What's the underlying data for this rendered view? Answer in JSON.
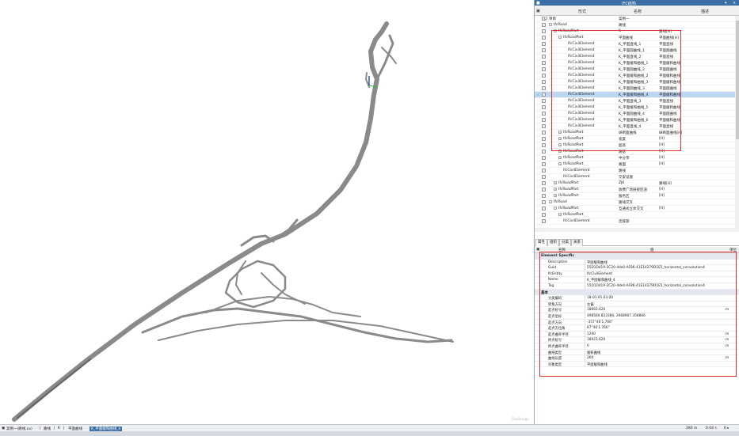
{
  "panel": {
    "title": "IFC结构",
    "columns": {
      "form": "形式",
      "name": "名称",
      "desc": "描述"
    },
    "tree_rows": [
      {
        "indent": 0,
        "form": "项目",
        "name": "案例一",
        "desc": "",
        "toggle": "−"
      },
      {
        "indent": 1,
        "form": "IfcRoad",
        "name": "路线",
        "desc": "",
        "toggle": "−"
      },
      {
        "indent": 2,
        "form": "IfcRoadPart",
        "name": "K",
        "desc": "路线[H]",
        "toggle": "−"
      },
      {
        "indent": 3,
        "form": "IfcRoadPart",
        "name": "平面曲线",
        "desc": "平面曲线[H]",
        "toggle": "−"
      },
      {
        "indent": 4,
        "form": "IfcCivilElement",
        "name": "K_平面直线_1",
        "desc": "平面直线",
        "toggle": ""
      },
      {
        "indent": 4,
        "form": "IfcCivilElement",
        "name": "K_平面圆曲线_1",
        "desc": "平面圆曲线",
        "toggle": ""
      },
      {
        "indent": 4,
        "form": "IfcCivilElement",
        "name": "K_平面直线_2",
        "desc": "平面直线",
        "toggle": ""
      },
      {
        "indent": 4,
        "form": "IfcCivilElement",
        "name": "K_平面缓和曲线_1",
        "desc": "平面缓和曲线",
        "toggle": ""
      },
      {
        "indent": 4,
        "form": "IfcCivilElement",
        "name": "K_平面圆曲线_2",
        "desc": "平面圆曲线",
        "toggle": ""
      },
      {
        "indent": 4,
        "form": "IfcCivilElement",
        "name": "K_平面缓和曲线_2",
        "desc": "平面缓和曲线",
        "toggle": ""
      },
      {
        "indent": 4,
        "form": "IfcCivilElement",
        "name": "K_平面缓和曲线_3",
        "desc": "平面缓和曲线",
        "toggle": ""
      },
      {
        "indent": 4,
        "form": "IfcCivilElement",
        "name": "K_平面圆曲线_3",
        "desc": "平面圆曲线",
        "toggle": ""
      },
      {
        "indent": 4,
        "form": "IfcCivilElement",
        "name": "K_平面缓和曲线_4",
        "desc": "平面缓和曲线",
        "toggle": "",
        "selected": true
      },
      {
        "indent": 4,
        "form": "IfcCivilElement",
        "name": "K_平面直线_3",
        "desc": "平面直线",
        "toggle": ""
      },
      {
        "indent": 4,
        "form": "IfcCivilElement",
        "name": "K_平面缓和曲线_5",
        "desc": "平面缓和曲线",
        "toggle": ""
      },
      {
        "indent": 4,
        "form": "IfcCivilElement",
        "name": "K_平面圆曲线_4",
        "desc": "平面圆曲线",
        "toggle": ""
      },
      {
        "indent": 4,
        "form": "IfcCivilElement",
        "name": "K_平面缓和曲线_6",
        "desc": "平面缓和曲线",
        "toggle": ""
      },
      {
        "indent": 4,
        "form": "IfcCivilElement",
        "name": "K_平面直线_4",
        "desc": "平面直线",
        "toggle": ""
      },
      {
        "indent": 3,
        "form": "IfcRoadPart",
        "name": "纵断面曲线",
        "desc": "纵断面曲线[H]",
        "toggle": "+"
      },
      {
        "indent": 3,
        "form": "IfcRoadPart",
        "name": "宽度",
        "desc": "[H]",
        "toggle": "+"
      },
      {
        "indent": 3,
        "form": "IfcRoadPart",
        "name": "超高",
        "desc": "[H]",
        "toggle": "+"
      },
      {
        "indent": 3,
        "form": "IfcRoadPart",
        "name": "路基",
        "desc": "[H]",
        "toggle": "+"
      },
      {
        "indent": 3,
        "form": "IfcRoadPart",
        "name": "中分带",
        "desc": "[H]",
        "toggle": "+"
      },
      {
        "indent": 3,
        "form": "IfcRoadPart",
        "name": "路面",
        "desc": "[H]",
        "toggle": "+"
      },
      {
        "indent": 3,
        "form": "IfcCivilElement",
        "name": "路线",
        "desc": "",
        "toggle": ""
      },
      {
        "indent": 3,
        "form": "IfcCivilElement",
        "name": "交安设施",
        "desc": "",
        "toggle": ""
      },
      {
        "indent": 2,
        "form": "IfcRoadPart",
        "name": "ZJK",
        "desc": "路线[H]",
        "toggle": "+"
      },
      {
        "indent": 2,
        "form": "IfcRoadPart",
        "name": "收费广场链接匝道",
        "desc": "[H]",
        "toggle": "+"
      },
      {
        "indent": 2,
        "form": "IfcRoadPart",
        "name": "服务区",
        "desc": "[H]",
        "toggle": "+"
      },
      {
        "indent": 1,
        "form": "IfcRoad",
        "name": "路线交叉",
        "desc": "",
        "toggle": "−"
      },
      {
        "indent": 2,
        "form": "IfcRoadPart",
        "name": "互通式立体交叉",
        "desc": "[H]",
        "toggle": "−"
      },
      {
        "indent": 3,
        "form": "IfcRoadPart",
        "name": "",
        "desc": "",
        "toggle": "+"
      },
      {
        "indent": 3,
        "form": "IfcCivilElement",
        "name": "连接部",
        "desc": "",
        "toggle": ""
      }
    ]
  },
  "tabs": [
    "属性",
    "组织",
    "分类",
    "关系"
  ],
  "props": {
    "col_name": "名称",
    "col_value": "值",
    "col_unit": "单位",
    "section1": "Element Specific",
    "section2": "基本",
    "rows1": [
      {
        "k": "Description",
        "v": "平面缓和曲线",
        "u": ""
      },
      {
        "k": "Guid",
        "v": "55D1D419-2C20-4de0-AF86-41E14279D1E5_horizontal_convolution4",
        "u": ""
      },
      {
        "k": "IfcEntity",
        "v": "IfcCivilElement",
        "u": ""
      },
      {
        "k": "Name",
        "v": "K_平面缓和曲线_4",
        "u": ""
      },
      {
        "k": "Tag",
        "v": "55D1D419-2C20-4de0-AF86-41E14279D1E5_horizontal_convolution4",
        "u": ""
      }
    ],
    "rows2": [
      {
        "k": "分类编码",
        "v": "18-01.01.03.00",
        "u": ""
      },
      {
        "k": "转角方向",
        "v": "左偏",
        "u": ""
      },
      {
        "k": "起点桩号",
        "v": "18663.626",
        "u": "m"
      },
      {
        "k": "起点坐标",
        "v": "498560.823380, 2668907.358866",
        "u": ""
      },
      {
        "k": "起点方向",
        "v": "-357°46'1.766\"",
        "u": ""
      },
      {
        "k": "起点方位角",
        "v": "87°46'1.766\"",
        "u": ""
      },
      {
        "k": "起点曲率半径",
        "v": "1200",
        "u": "m"
      },
      {
        "k": "终点桩号",
        "v": "18923.626",
        "u": "m"
      },
      {
        "k": "终点曲率半径",
        "v": "0",
        "u": "m"
      },
      {
        "k": "曲线类型",
        "v": "缓和曲线",
        "u": ""
      },
      {
        "k": "曲线长度",
        "v": "260",
        "u": "m"
      },
      {
        "k": "对象类型",
        "v": "平面缓和曲线",
        "u": ""
      }
    ]
  },
  "status": {
    "items": [
      "案例一(路线.xx)",
      "路线",
      "K",
      "平面曲线",
      "K_平面缓和曲线_4"
    ],
    "scale": "280 m",
    "time": "0.04 s",
    "zoom": "6 ▸"
  },
  "viewport": {
    "watermark": "GeoDesign"
  },
  "colors": {
    "accent": "#3b6ea5",
    "highlight": "#e03030",
    "road": "#8a8a8a"
  }
}
